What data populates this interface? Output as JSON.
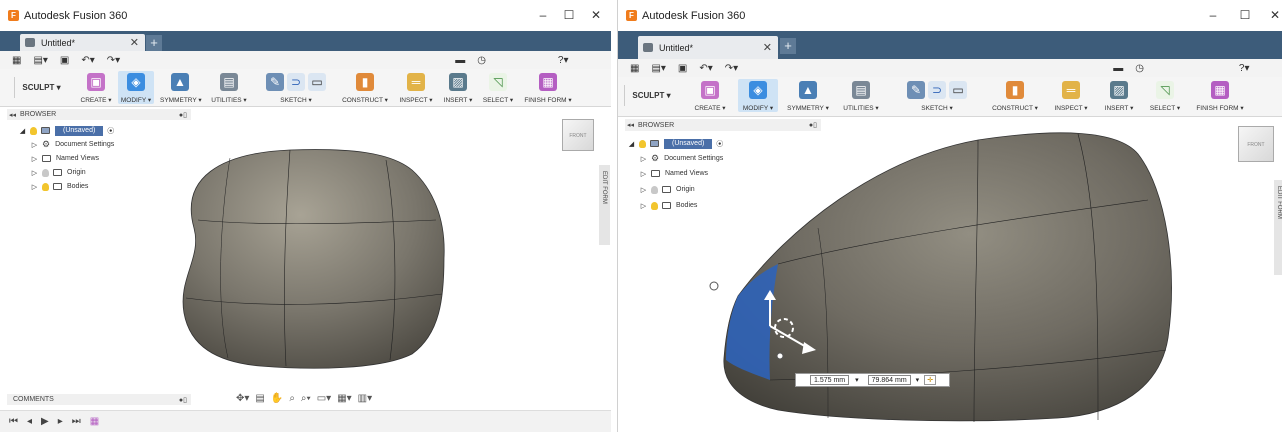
{
  "app": {
    "title": "Autodesk Fusion 360",
    "logo_letter": "F",
    "controls": {
      "minimize": "–",
      "maximize": "☐",
      "close": "✕"
    }
  },
  "tab": {
    "label": "Untitled*",
    "close": "✕",
    "new": "+"
  },
  "toolbar": {
    "workspace": "SCULPT ▾",
    "groups": [
      "CREATE ▾",
      "MODIFY ▾",
      "SYMMETRY ▾",
      "UTILITIES ▾",
      "SKETCH ▾",
      "CONSTRUCT ▾",
      "INSPECT ▾",
      "INSERT ▾",
      "SELECT ▾",
      "FINISH FORM ▾"
    ]
  },
  "browser": {
    "header": "BROWSER",
    "root": "(Unsaved)",
    "items": [
      "Document Settings",
      "Named Views",
      "Origin",
      "Bodies"
    ]
  },
  "comments": {
    "header": "COMMENTS"
  },
  "side_panel": {
    "label": "EDIT FORM"
  },
  "viewcube": {
    "face": "FRONT"
  },
  "dimensions": {
    "first": "1.575 mm",
    "second": "79.864 mm"
  },
  "colors": {
    "tab_bar": "#3d5c7a",
    "accent": "#4a6fa8",
    "selection": "#2f63b8"
  },
  "icons": [
    "grid-icon",
    "file-icon",
    "save-icon",
    "undo-icon",
    "redo-icon",
    "chat-icon",
    "clock-icon",
    "help-icon",
    "gear-icon",
    "lightbulb-icon",
    "folder-icon",
    "orbit-icon",
    "pan-icon",
    "zoom-icon",
    "display-icon",
    "grid-display-icon",
    "play-first-icon",
    "play-prev-icon",
    "play-icon",
    "play-next-icon",
    "play-last-icon"
  ]
}
